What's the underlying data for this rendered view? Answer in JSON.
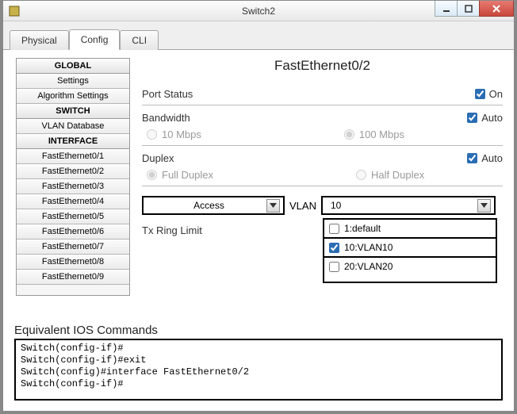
{
  "window": {
    "title": "Switch2"
  },
  "tabs": {
    "physical": "Physical",
    "config": "Config",
    "cli": "CLI",
    "active": "config"
  },
  "sidebar": {
    "sections": [
      {
        "header": "GLOBAL",
        "items": [
          "Settings",
          "Algorithm Settings"
        ]
      },
      {
        "header": "SWITCH",
        "items": [
          "VLAN Database"
        ]
      },
      {
        "header": "INTERFACE",
        "items": [
          "FastEthernet0/1",
          "FastEthernet0/2",
          "FastEthernet0/3",
          "FastEthernet0/4",
          "FastEthernet0/5",
          "FastEthernet0/6",
          "FastEthernet0/7",
          "FastEthernet0/8",
          "FastEthernet0/9"
        ]
      }
    ]
  },
  "main": {
    "heading": "FastEthernet0/2",
    "port_status": {
      "label": "Port Status",
      "value_label": "On",
      "checked": true
    },
    "bandwidth": {
      "label": "Bandwidth",
      "auto_label": "Auto",
      "auto_checked": true,
      "opt1": "10 Mbps",
      "opt2": "100 Mbps",
      "selected": "100 Mbps",
      "disabled": true
    },
    "duplex": {
      "label": "Duplex",
      "auto_label": "Auto",
      "auto_checked": true,
      "opt1": "Full Duplex",
      "opt2": "Half Duplex",
      "selected": "Full Duplex",
      "disabled": true
    },
    "mode": {
      "value": "Access"
    },
    "vlan": {
      "label": "VLAN",
      "value": "10",
      "options": [
        {
          "label": "1:default",
          "checked": false
        },
        {
          "label": "10:VLAN10",
          "checked": true
        },
        {
          "label": "20:VLAN20",
          "checked": false
        }
      ],
      "open": true
    },
    "tx_ring": {
      "label": "Tx Ring Limit"
    }
  },
  "ios": {
    "title": "Equivalent IOS Commands",
    "lines": [
      "Switch(config-if)#",
      "Switch(config-if)#exit",
      "Switch(config)#interface FastEthernet0/2",
      "Switch(config-if)#"
    ]
  }
}
